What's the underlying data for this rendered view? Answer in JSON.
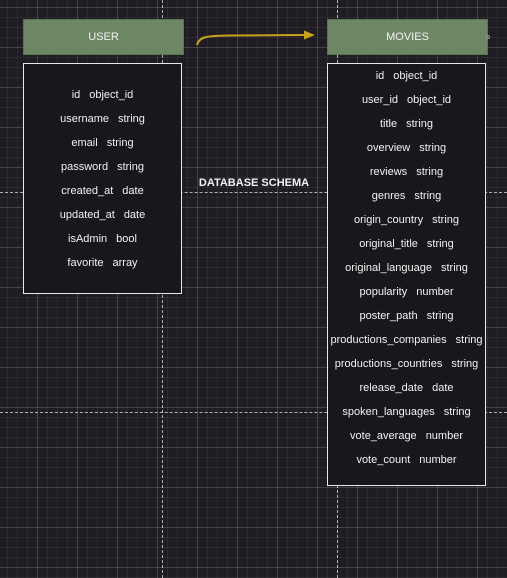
{
  "diagram": {
    "title": "DATABASE SCHEMA",
    "colors": {
      "header_fill": "#6d8764",
      "body_fill": "#18171c",
      "border": "#e8e8e8",
      "connector": "#c7a41b"
    },
    "user_table": {
      "name": "USER",
      "fields": [
        {
          "name": "id",
          "type": "object_id"
        },
        {
          "name": "username",
          "type": "string"
        },
        {
          "name": "email",
          "type": "string"
        },
        {
          "name": "password",
          "type": "string"
        },
        {
          "name": "created_at",
          "type": "date"
        },
        {
          "name": "updated_at",
          "type": "date"
        },
        {
          "name": "isAdmin",
          "type": "bool"
        },
        {
          "name": "favorite",
          "type": "array"
        }
      ]
    },
    "movies_table": {
      "name": "MOVIES",
      "fields": [
        {
          "name": "id",
          "type": "object_id"
        },
        {
          "name": "user_id",
          "type": "object_id"
        },
        {
          "name": "title",
          "type": "string"
        },
        {
          "name": "overview",
          "type": "string"
        },
        {
          "name": "reviews",
          "type": "string"
        },
        {
          "name": "genres",
          "type": "string"
        },
        {
          "name": "origin_country",
          "type": "string"
        },
        {
          "name": "original_title",
          "type": "string"
        },
        {
          "name": "original_language",
          "type": "string"
        },
        {
          "name": "popularity",
          "type": "number"
        },
        {
          "name": "poster_path",
          "type": "string"
        },
        {
          "name": "productions_companies",
          "type": "string"
        },
        {
          "name": "productions_countries",
          "type": "string"
        },
        {
          "name": "release_date",
          "type": "date"
        },
        {
          "name": "spoken_languages",
          "type": "string"
        },
        {
          "name": "vote_average",
          "type": "number"
        },
        {
          "name": "vote_count",
          "type": "number"
        }
      ]
    }
  }
}
